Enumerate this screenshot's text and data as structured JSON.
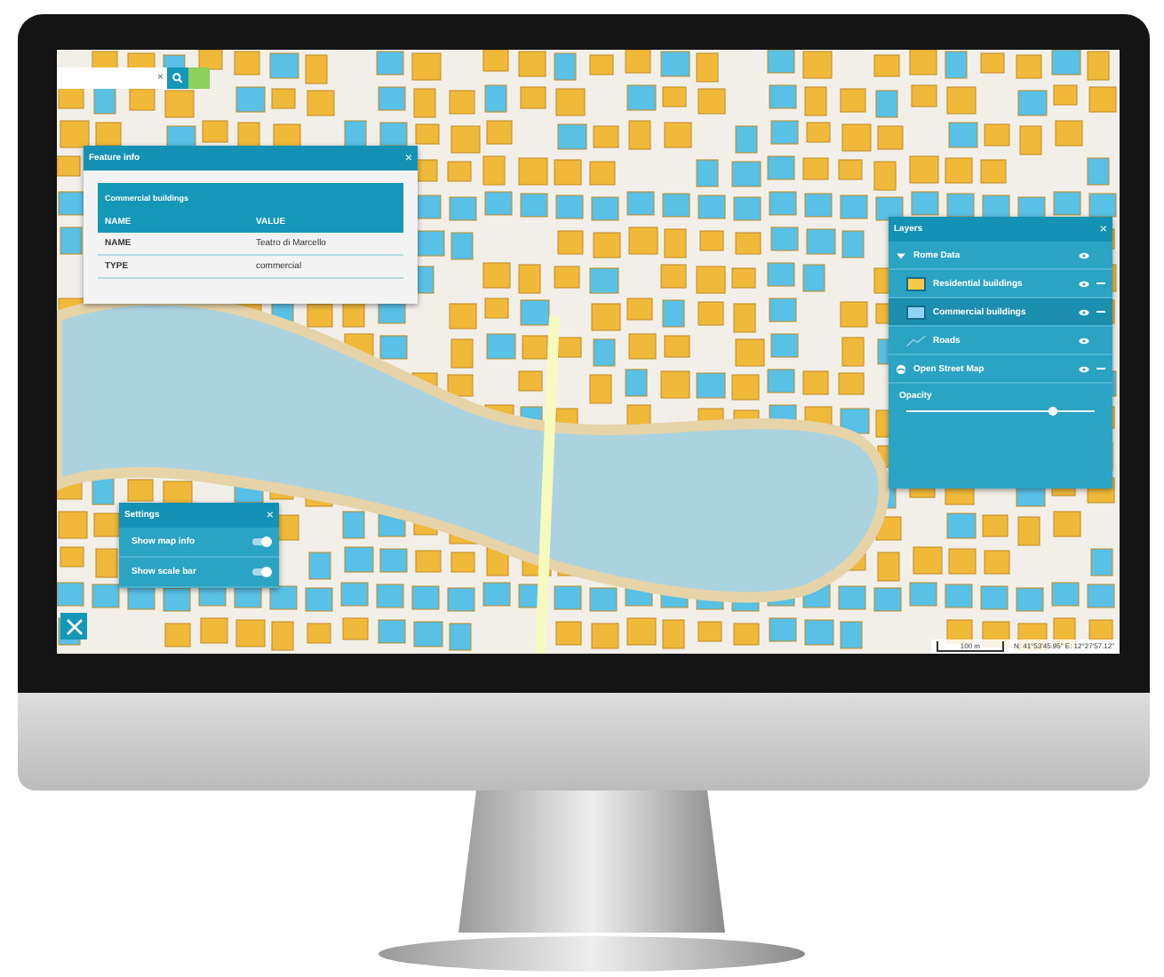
{
  "search": {
    "clear": "×"
  },
  "feature_info": {
    "title": "Feature info",
    "close": "×",
    "layer": "Commercial buildings",
    "columns": [
      "NAME",
      "VALUE"
    ],
    "rows": [
      {
        "name": "NAME",
        "value": "Teatro di Marcello"
      },
      {
        "name": "TYPE",
        "value": "commercial"
      }
    ]
  },
  "layers": {
    "title": "Layers",
    "close": "×",
    "groups": [
      {
        "name": "Rome Data",
        "kind": "group",
        "expanded": true,
        "children": [
          {
            "name": "Residential buildings",
            "kind": "polygon",
            "color": "#f5c94a"
          },
          {
            "name": "Commercial buildings",
            "kind": "polygon",
            "color": "#8fd3f4"
          },
          {
            "name": "Roads",
            "kind": "line"
          }
        ]
      },
      {
        "name": "Open Street Map",
        "kind": "basemap"
      }
    ],
    "opacity": {
      "label": "Opacity",
      "level": 0.78
    }
  },
  "settings": {
    "title": "Settings",
    "close": "×",
    "toggles": [
      {
        "label": "Show map info",
        "on": true
      },
      {
        "label": "Show scale bar",
        "on": true
      }
    ]
  },
  "scale": {
    "label": "100 m",
    "coordinates": "N: 41°53'45.95\" E: 12°27'57.12\""
  }
}
